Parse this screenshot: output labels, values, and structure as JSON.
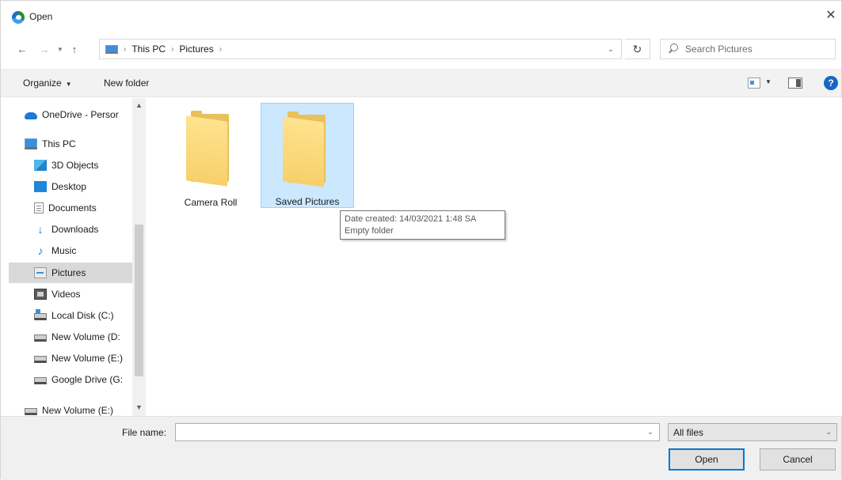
{
  "window": {
    "title": "Open",
    "close_glyph": "✕"
  },
  "nav_buttons": {
    "back": "←",
    "forward": "→",
    "recent": "▼",
    "up": "↑"
  },
  "address": {
    "crumbs": [
      "This PC",
      "Pictures"
    ],
    "separator": "›",
    "dropdown_glyph": "⌄",
    "refresh_glyph": "↻"
  },
  "search": {
    "placeholder": "Search Pictures"
  },
  "toolbar": {
    "organize_label": "Organize",
    "caret": "▼",
    "new_folder_label": "New folder",
    "help_glyph": "?"
  },
  "nav_pane": {
    "items": [
      {
        "label": "OneDrive - Persor",
        "icon": "cloud-icon"
      },
      {
        "label": "This PC",
        "icon": "pc-icon"
      },
      {
        "label": "3D Objects",
        "icon": "3d-objects-icon"
      },
      {
        "label": "Desktop",
        "icon": "desktop-icon"
      },
      {
        "label": "Documents",
        "icon": "documents-icon"
      },
      {
        "label": "Downloads",
        "icon": "downloads-icon"
      },
      {
        "label": "Music",
        "icon": "music-icon"
      },
      {
        "label": "Pictures",
        "icon": "pictures-icon",
        "selected": true
      },
      {
        "label": "Videos",
        "icon": "videos-icon"
      },
      {
        "label": "Local Disk (C:)",
        "icon": "local-disk-icon"
      },
      {
        "label": "New Volume (D:",
        "icon": "drive-icon"
      },
      {
        "label": "New Volume (E:)",
        "icon": "drive-icon"
      },
      {
        "label": "Google Drive (G:",
        "icon": "drive-icon"
      },
      {
        "label": "New Volume (E:)",
        "icon": "drive-icon"
      }
    ],
    "scroll_up": "▲",
    "scroll_down": "▼"
  },
  "content": {
    "folders": [
      {
        "name": "Camera Roll",
        "selected": false
      },
      {
        "name": "Saved Pictures",
        "selected": true
      }
    ],
    "tooltip": {
      "line1": "Date created: 14/03/2021 1:48 SA",
      "line2": "Empty folder"
    }
  },
  "bottom": {
    "file_name_label": "File name:",
    "file_name_value": "",
    "dropdown_glyph": "⌄",
    "file_type": "All files",
    "open_label": "Open",
    "cancel_label": "Cancel"
  },
  "colors": {
    "selection_fill": "#cce8ff",
    "selection_border": "#99d1ff",
    "accent": "#0078d7",
    "folder": "#f7d06a"
  }
}
